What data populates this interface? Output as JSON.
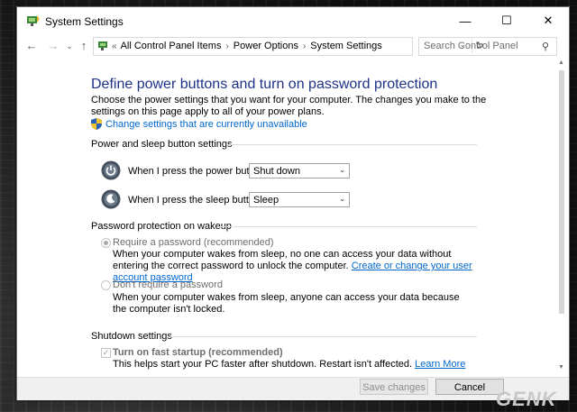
{
  "window": {
    "title": "System Settings",
    "minimize_glyph": "—",
    "maximize_glyph": "☐",
    "close_glyph": "✕"
  },
  "address": {
    "back_glyph": "←",
    "forward_glyph": "→",
    "recent_glyph": "⌄",
    "up_glyph": "↑",
    "lead": "«",
    "breadcrumbs": [
      "All Control Panel Items",
      "Power Options",
      "System Settings"
    ],
    "separator": "›",
    "dropdown_glyph": "⌄",
    "refresh_glyph": "↻",
    "search_placeholder": "Search Control Panel",
    "search_glyph": "⚲"
  },
  "page": {
    "heading": "Define power buttons and turn on password protection",
    "intro": "Choose the power settings that you want for your computer. The changes you make to the settings on this page apply to all of your power plans.",
    "change_link": "Change settings that are currently unavailable"
  },
  "power_section": {
    "title": "Power and sleep button settings",
    "power_label": "When I press the power button:",
    "power_value": "Shut down",
    "sleep_label": "When I press the sleep button:",
    "sleep_value": "Sleep",
    "chevron": "⌄"
  },
  "password_section": {
    "title": "Password protection on wakeup",
    "require_label": "Require a password (recommended)",
    "require_desc": "When your computer wakes from sleep, no one can access your data without entering the correct password to unlock the computer.",
    "require_link": "Create or change your user account password",
    "norequire_label": "Don't require a password",
    "norequire_desc": "When your computer wakes from sleep, anyone can access your data because the computer isn't locked."
  },
  "shutdown_section": {
    "title": "Shutdown settings",
    "fast_startup_label": "Turn on fast startup (recommended)",
    "fast_startup_checked": true,
    "check_glyph": "✓",
    "fast_startup_desc": "This helps start your PC faster after shutdown. Restart isn't affected.",
    "learn_more": "Learn More"
  },
  "scrollbar": {
    "up_glyph": "▲",
    "down_glyph": "▼"
  },
  "footer": {
    "save_label": "Save changes",
    "cancel_label": "Cancel"
  },
  "watermark": {
    "text": "GENK"
  },
  "colors": {
    "heading": "#1e3287",
    "link": "#0066cc",
    "section_line": "#dcdcdc"
  }
}
